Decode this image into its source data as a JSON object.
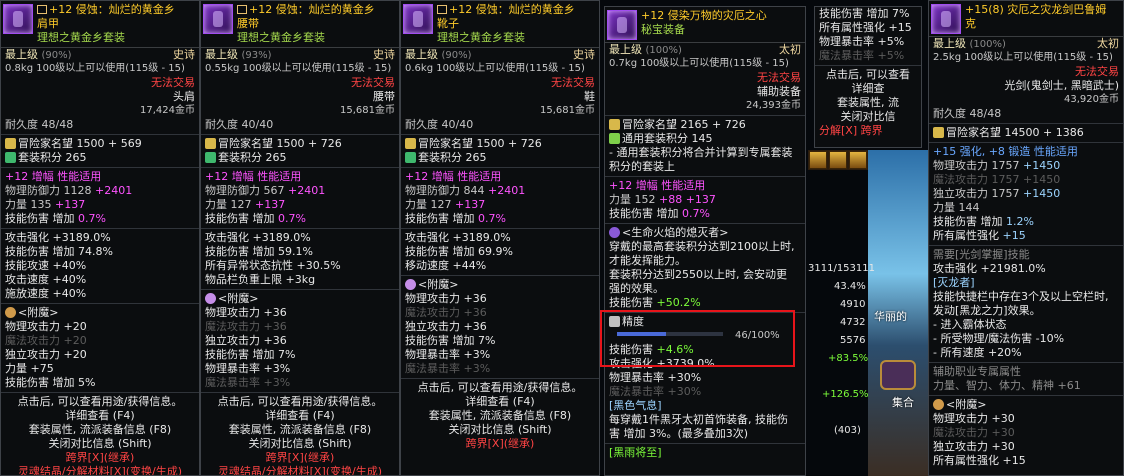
{
  "panels": [
    {
      "title": "+12 侵蚀：灿烂的黄金乡",
      "subtitle": "肩甲",
      "set_name": "理想之黄金乡套装",
      "grade": "最上级",
      "grade_pct": "(90%)",
      "rarity": "史诗",
      "weight_req": "0.8kg  100级以上可以使用(115级 - 15)",
      "trade": "无法交易",
      "slot": "头肩",
      "price": "17,424金币",
      "durability": "耐久度 48/48",
      "adv_fame": "冒险家名望 1500 + 569",
      "set_points": "套装积分 265",
      "amp": "+12 增幅 性能适用",
      "def_label": "物理防御力 1128",
      "def_bonus": "+2401",
      "str_label": "力量 135",
      "str_bonus": "+137",
      "skill_label": "技能伤害 增加",
      "skill_pct": "0.7%",
      "stats": [
        "攻击强化 +3189.0%",
        "技能伤害 增加 74.8%",
        "技能攻速 +40%",
        "攻击速度 +40%",
        "施放速度 +40%"
      ],
      "enchant_title": "<附魔>",
      "enchant": [
        {
          "t": "物理攻击力 +20",
          "c": "white"
        },
        {
          "t": "魔法攻击力 +20",
          "c": "dim"
        },
        {
          "t": "独立攻击力 +20",
          "c": "white"
        },
        {
          "t": "力量 +75",
          "c": "white"
        },
        {
          "t": "技能伤害 增加 5%",
          "c": "white"
        }
      ],
      "footer": [
        "点击后, 可以查看用途/获得信息。",
        "详细查看 (F4)",
        "套装属性, 流派装备信息 (F8)",
        "关闭对比信息 (Shift)",
        "跨界[X](继承)",
        "灵魂结晶/分解材料[X](变换/生成)"
      ]
    },
    {
      "title": "+12 侵蚀：灿烂的黄金乡",
      "subtitle": "腰带",
      "set_name": "理想之黄金乡套装",
      "grade": "最上级",
      "grade_pct": "(93%)",
      "rarity": "史诗",
      "weight_req": "0.55kg 100级以上可以使用(115级 - 15)",
      "trade": "无法交易",
      "slot": "腰带",
      "price": "15,681金币",
      "durability": "耐久度 40/40",
      "adv_fame": "冒险家名望 1500 + 726",
      "set_points": "套装积分 265",
      "amp": "+12 增幅 性能适用",
      "def_label": "物理防御力 567",
      "def_bonus": "+2401",
      "str_label": "力量 127",
      "str_bonus": "+137",
      "skill_label": "技能伤害 增加",
      "skill_pct": "0.7%",
      "stats": [
        "攻击强化 +3189.0%",
        "技能伤害 增加 59.1%",
        "所有异常状态抗性 +30.5%",
        "物品栏负重上限 +3kg"
      ],
      "enchant_title": "<附魔>",
      "enchant": [
        {
          "t": "物理攻击力 +36",
          "c": "white"
        },
        {
          "t": "魔法攻击力 +36",
          "c": "dim"
        },
        {
          "t": "独立攻击力 +36",
          "c": "white"
        },
        {
          "t": "技能伤害 增加 7%",
          "c": "white"
        },
        {
          "t": "物理暴击率 +3%",
          "c": "white"
        },
        {
          "t": "魔法暴击率 +3%",
          "c": "dim"
        }
      ],
      "footer": [
        "点击后, 可以查看用途/获得信息。",
        "详细查看 (F4)",
        "套装属性, 流派装备信息 (F8)",
        "关闭对比信息 (Shift)",
        "跨界[X](继承)",
        "灵魂结晶/分解材料[X](变换/生成)"
      ]
    },
    {
      "title": "+12 侵蚀：灿烂的黄金乡",
      "subtitle": "靴子",
      "set_name": "理想之黄金乡套装",
      "grade": "最上级",
      "grade_pct": "(90%)",
      "rarity": "史诗",
      "weight_req": "0.6kg  100级以上可以使用(115级 - 15)",
      "trade": "无法交易",
      "slot": "鞋",
      "price": "15,681金币",
      "durability": "耐久度 40/40",
      "adv_fame": "冒险家名望 1500 + 726",
      "set_points": "套装积分 265",
      "amp": "+12 增幅 性能适用",
      "def_label": "物理防御力 844",
      "def_bonus": "+2401",
      "str_label": "力量 127",
      "str_bonus": "+137",
      "skill_label": "技能伤害 增加",
      "skill_pct": "0.7%",
      "stats": [
        "攻击强化 +3189.0%",
        "技能伤害 增加 69.9%",
        "移动速度 +44%"
      ],
      "enchant_title": "<附魔>",
      "enchant": [
        {
          "t": "物理攻击力 +36",
          "c": "white"
        },
        {
          "t": "魔法攻击力 +36",
          "c": "dim"
        },
        {
          "t": "独立攻击力 +36",
          "c": "white"
        },
        {
          "t": "技能伤害 增加 7%",
          "c": "white"
        },
        {
          "t": "物理暴击率 +3%",
          "c": "white"
        },
        {
          "t": "魔法暴击率 +3%",
          "c": "dim"
        }
      ],
      "footer": [
        "点击后, 可以查看用途/获得信息。",
        "详细查看 (F4)",
        "套装属性, 流派装备信息 (F8)",
        "关闭对比信息 (Shift)",
        "跨界[X](继承)"
      ]
    }
  ],
  "center": {
    "title": "+12 侵染万物的灾厄之心",
    "subtitle": "秘宝装备",
    "grade": "最上级",
    "grade_pct": "(100%)",
    "rarity": "太初",
    "weight_req": "0.7kg  100级以上可以使用(115级 - 15)",
    "trade": "无法交易",
    "slot": "辅助装备",
    "price": "24,393金币",
    "adv_fame": "冒险家名望 2165 + 726",
    "set_points": "通用套装积分 145",
    "set_desc": "- 通用套装积分将合并计算到专属套装积分的套装上",
    "amp": "+12 增幅 性能适用",
    "str_label": "力量 152",
    "str_bonus": "+88",
    "str_bonus2": "+137",
    "skill_label": "技能伤害 增加",
    "skill_pct": "0.7%",
    "buff_title": "<生命火焰的熄灭者>",
    "buff_desc": [
      "穿戴的最高套装积分达到2100以上时,",
      "才能发挥能力。",
      "套装积分达到2550以上时, 会安动更",
      "强的效果。"
    ],
    "buff_skill_label": "技能伤害",
    "buff_skill_val": "+50.2%",
    "precision_label": "精度",
    "precision_value": "46/100%",
    "precision_fraction": 0.46,
    "precision_skill_label": "技能伤害",
    "precision_skill_val": "+4.6%",
    "attack_line": "攻击强化 +3739.0%",
    "crit_line": "物理暴击率 +30%",
    "magic_crit_line": "魔法暴击率 +30%",
    "black_tooth_title": "[黑色气息]",
    "black_tooth_desc": [
      "每穿戴1件黑牙太初首饰装备, 技能伤",
      "害 增加 3%。(最多叠加3次)"
    ],
    "bottom_tag": "[黑雨将至]"
  },
  "compare": {
    "skill_inc": "技能伤害 增加 7%",
    "all_attr": "所有属性强化 +15",
    "phys_crit": "物理暴击率 +5%",
    "magic_crit": "魔法暴击率 +5%",
    "click": "点击后, 可以查看",
    "detail": "详细查",
    "set_attr": "套装属性, 流",
    "close_cmp": "关闭对比信",
    "split": "分解[X]",
    "cross": "跨界"
  },
  "side": {
    "num1": "3111/153111",
    "v1": "43.4%",
    "v2": "4910",
    "v3": "4732",
    "v4": "5576",
    "v5": "+83.5%",
    "v6": "+126.5%",
    "v7": "(403)",
    "scene_label": "华丽的",
    "scene_label2": "集合"
  },
  "right": {
    "title": "+15(8) 灾厄之灾龙剑巴鲁姆",
    "title2": "克",
    "grade": "最上级",
    "grade_pct": "(100%)",
    "rarity": "太初",
    "weight_req": "2.5kg  100级以上可以使用(115级 - 15)",
    "trade": "无法交易",
    "cls": "光剑(鬼剑士, 黑暗武士)",
    "price": "43,920金币",
    "durability": "耐久度 48/48",
    "adv_fame": "冒险家名望 14500 + 1386",
    "refine": "+15 强化, +8 锻造 性能适用",
    "patk": "物理攻击力 1757",
    "patk_b": "+1450",
    "matk": "魔法攻击力 1757",
    "matk_b": "+1450",
    "iatk": "独立攻击力 1757",
    "iatk_b": "+1450",
    "str": "力量 144",
    "skill": "技能伤害 增加",
    "skill_pct": "1.2%",
    "allatk": "所有属性强化",
    "allatk_v": "+15",
    "need": "需要[光剑掌握]技能",
    "atk_str": "攻击强化 +21981.0%",
    "grey_title": "[灭龙者]",
    "grey_desc": [
      "技能快捷栏中存在3个及以上空栏时,",
      "发动[黑龙之力]效果。",
      "- 进入霸体状态",
      "- 所受物理/魔法伤害 -10%",
      "- 所有速度 +20%"
    ],
    "aux": "辅助职业专属属性",
    "aux_stat": "力量、智力、体力、精神 +61",
    "enchant_title": "<附魔>",
    "enchant": [
      {
        "t": "物理攻击力 +30",
        "c": "white"
      },
      {
        "t": "魔法攻击力 +30",
        "c": "dim"
      },
      {
        "t": "独立攻击力 +30",
        "c": "white"
      },
      {
        "t": "所有属性强化 +15",
        "c": "white"
      }
    ]
  }
}
